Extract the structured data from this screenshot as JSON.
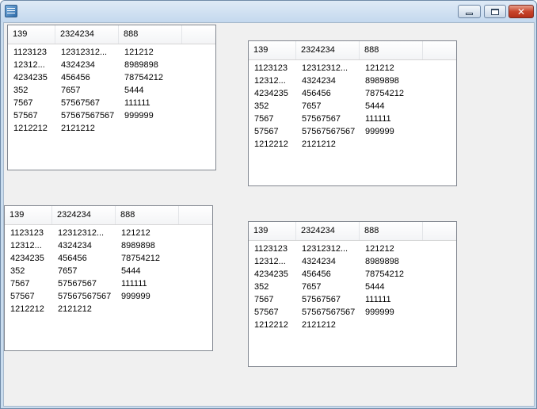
{
  "window": {
    "icon": "app-icon",
    "controls": [
      "minimize-icon",
      "maximize-icon",
      "close-icon"
    ],
    "close_glyph": "✕"
  },
  "listviews": [
    {
      "columns": [
        "139",
        "2324234",
        "888"
      ],
      "rows": [
        [
          "1123123",
          "12312312...",
          "121212"
        ],
        [
          "12312...",
          "4324234",
          "8989898"
        ],
        [
          "4234235",
          "456456",
          "78754212"
        ],
        [
          "352",
          "7657",
          "5444"
        ],
        [
          "7567",
          "57567567",
          "111111"
        ],
        [
          "57567",
          "57567567567",
          "999999"
        ],
        [
          "1212212",
          "2121212",
          ""
        ]
      ]
    },
    {
      "columns": [
        "139",
        "2324234",
        "888"
      ],
      "rows": [
        [
          "1123123",
          "12312312...",
          "121212"
        ],
        [
          "12312...",
          "4324234",
          "8989898"
        ],
        [
          "4234235",
          "456456",
          "78754212"
        ],
        [
          "352",
          "7657",
          "5444"
        ],
        [
          "7567",
          "57567567",
          "111111"
        ],
        [
          "57567",
          "57567567567",
          "999999"
        ],
        [
          "1212212",
          "2121212",
          ""
        ]
      ]
    },
    {
      "columns": [
        "139",
        "2324234",
        "888"
      ],
      "rows": [
        [
          "1123123",
          "12312312...",
          "121212"
        ],
        [
          "12312...",
          "4324234",
          "8989898"
        ],
        [
          "4234235",
          "456456",
          "78754212"
        ],
        [
          "352",
          "7657",
          "5444"
        ],
        [
          "7567",
          "57567567",
          "111111"
        ],
        [
          "57567",
          "57567567567",
          "999999"
        ],
        [
          "1212212",
          "2121212",
          ""
        ]
      ]
    },
    {
      "columns": [
        "139",
        "2324234",
        "888"
      ],
      "rows": [
        [
          "1123123",
          "12312312...",
          "121212"
        ],
        [
          "12312...",
          "4324234",
          "8989898"
        ],
        [
          "4234235",
          "456456",
          "78754212"
        ],
        [
          "352",
          "7657",
          "5444"
        ],
        [
          "7567",
          "57567567",
          "111111"
        ],
        [
          "57567",
          "57567567567",
          "999999"
        ],
        [
          "1212212",
          "2121212",
          ""
        ]
      ]
    }
  ]
}
